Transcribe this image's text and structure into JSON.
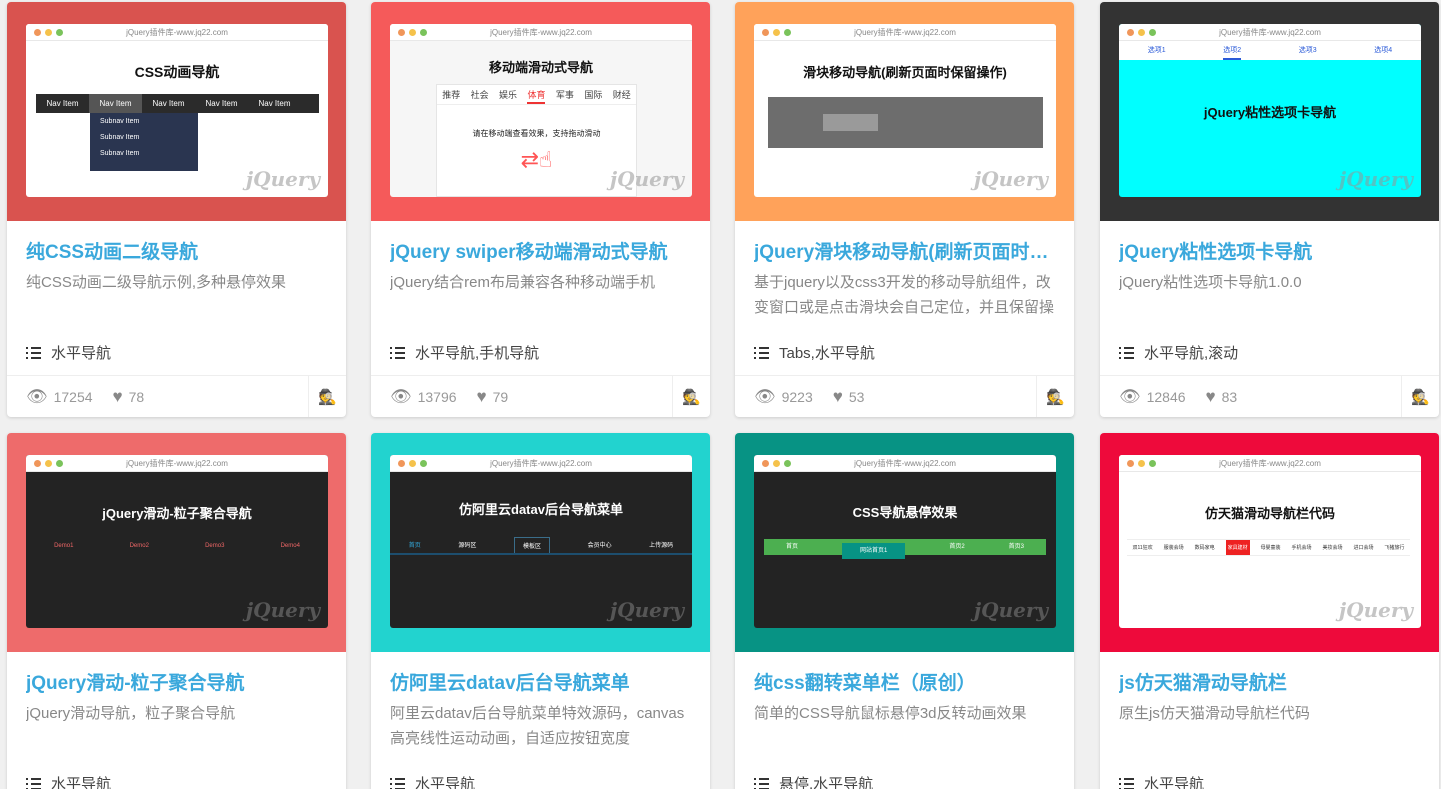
{
  "cards": [
    {
      "thumb_color": "#d9534f",
      "url": "jQuery插件库-www.jq22.com",
      "preview_title": "CSS动画导航",
      "nav_items": [
        "Nav Item",
        "Nav Item",
        "Nav Item",
        "Nav Item",
        "Nav Item"
      ],
      "subnav_items": [
        "Subnav Item",
        "Subnav Item",
        "Subnav Item"
      ],
      "title": "纯CSS动画二级导航",
      "desc": "纯CSS动画二级导航示例,多种悬停效果",
      "tags": "水平导航",
      "views": "17254",
      "likes": "78"
    },
    {
      "thumb_color": "#f55a5a",
      "url": "jQuery插件库-www.jq22.com",
      "preview_title": "移动端滑动式导航",
      "tabs": [
        "推荐",
        "社会",
        "娱乐",
        "体育",
        "军事",
        "国际",
        "财经"
      ],
      "hint": "请在移动端查看效果，支持拖动滑动",
      "title": "jQuery swiper移动端滑动式导航",
      "desc": "jQuery结合rem布局兼容各种移动端手机",
      "tags": "水平导航,手机导航",
      "views": "13796",
      "likes": "79"
    },
    {
      "thumb_color": "#ffa25a",
      "url": "jQuery插件库-www.jq22.com",
      "preview_title": "滑块移动导航(刷新页面时保留操作)",
      "title": "jQuery滑块移动导航(刷新页面时保...",
      "desc": "基于jquery以及css3开发的移动导航组件，改变窗口或是点击滑块会自己定位，并且保留操",
      "tags": "Tabs,水平导航",
      "views": "9223",
      "likes": "53"
    },
    {
      "thumb_color": "#333333",
      "url": "jQuery插件库-www.jq22.com",
      "preview_title": "jQuery粘性选项卡导航",
      "tabs": [
        "选项1",
        "选项2",
        "选项3",
        "选项4"
      ],
      "title": "jQuery粘性选项卡导航",
      "desc": "jQuery粘性选项卡导航1.0.0",
      "tags": "水平导航,滚动",
      "views": "12846",
      "likes": "83"
    },
    {
      "thumb_color": "#ee6b6b",
      "url": "jQuery插件库-www.jq22.com",
      "preview_title": "jQuery滑动-粒子聚合导航",
      "demos": [
        "Demo1",
        "Demo2",
        "Demo3",
        "Demo4"
      ],
      "title": "jQuery滑动-粒子聚合导航",
      "desc": "jQuery滑动导航，粒子聚合导航",
      "tags": "水平导航"
    },
    {
      "thumb_color": "#22d3cf",
      "url": "jQuery插件库-www.jq22.com",
      "preview_title": "仿阿里云datav后台导航菜单",
      "menu": [
        "首页",
        "源码区",
        "模板区",
        "会员中心",
        "上传源码"
      ],
      "title": "仿阿里云datav后台导航菜单",
      "desc": "阿里云datav后台导航菜单特效源码，canvas高亮线性运动动画，自适应按钮宽度",
      "tags": "水平导航"
    },
    {
      "thumb_color": "#079384",
      "url": "jQuery插件库-www.jq22.com",
      "preview_title": "CSS导航悬停效果",
      "menu": [
        "首页",
        "网站首页1",
        "首页2",
        "首页3"
      ],
      "title": "纯css翻转菜单栏（原创）",
      "desc": "简单的CSS导航鼠标悬停3d反转动画效果",
      "tags": "悬停,水平导航"
    },
    {
      "thumb_color": "#ee0a3b",
      "url": "jQuery插件库-www.jq22.com",
      "preview_title": "仿天猫滑动导航栏代码",
      "menu": [
        "双11狂欢",
        "服装会场",
        "数码家电",
        "家具建材",
        "母婴童装",
        "手机会场",
        "美妆会场",
        "进口会场",
        "飞猪旅行"
      ],
      "title": "js仿天猫滑动导航栏",
      "desc": "原生js仿天猫滑动导航栏代码",
      "tags": "水平导航"
    }
  ],
  "icons": {
    "views": "eye-icon",
    "likes": "heart-icon",
    "author": "spy-icon",
    "tags": "list-icon"
  },
  "link_color": "#3aa8dc"
}
